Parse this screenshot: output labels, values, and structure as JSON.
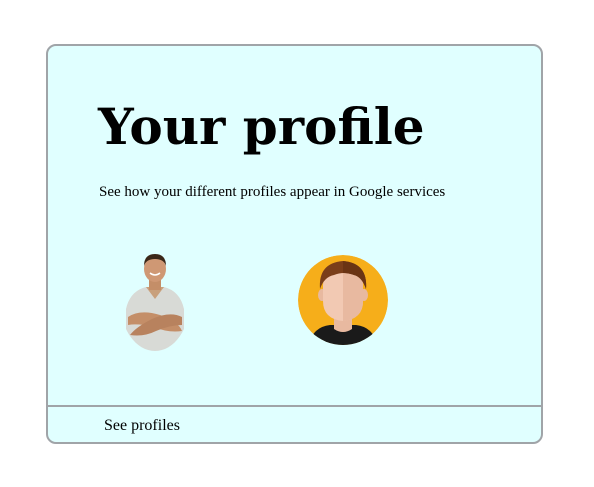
{
  "card": {
    "title": "Your profile",
    "subtitle": "See how your different profiles appear in Google services",
    "avatars": [
      {
        "icon": "person-photo-avatar"
      },
      {
        "icon": "cartoon-person-avatar",
        "background": "#f6ae1a"
      }
    ],
    "footer_link": "See profiles"
  },
  "colors": {
    "card_background": "#e0ffff",
    "card_border": "#a0a4a8"
  }
}
